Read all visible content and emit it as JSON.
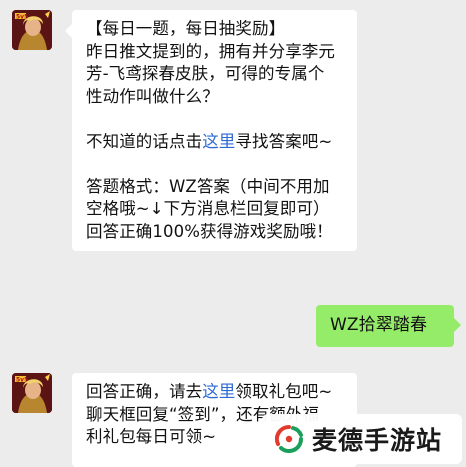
{
  "messages": {
    "question": {
      "lines": [
        "【每日一题，每日抽奖励】",
        "昨日推文提到的，拥有并分享李元",
        "芳-飞鸢探春皮肤，可得的专属个",
        "性动作叫做什么？"
      ],
      "hint_prefix": "不知道的话点击",
      "hint_link": "这里",
      "hint_suffix": "寻找答案吧~",
      "format_lines": [
        "答题格式：WZ答案（中间不用加",
        "空格哦~↓下方消息栏回复即可）",
        "回答正确100%获得游戏奖励哦！"
      ]
    },
    "reply": {
      "text": "WZ拾翠踏春"
    },
    "answer": {
      "line1_prefix": "回答正确，请去",
      "line1_link": "这里",
      "line1_suffix": "领取礼包吧~",
      "line2": "聊天框回复“签到”，还有额外福",
      "line3": "利礼包每日可领~"
    }
  },
  "watermark": {
    "brand": "麦德手游站"
  },
  "colors": {
    "background": "#ececec",
    "incoming_bubble": "#ffffff",
    "outgoing_bubble": "#95ec69",
    "link": "#2d6ad3",
    "watermark_red": "#e23b2e",
    "watermark_green": "#1aa05a"
  }
}
